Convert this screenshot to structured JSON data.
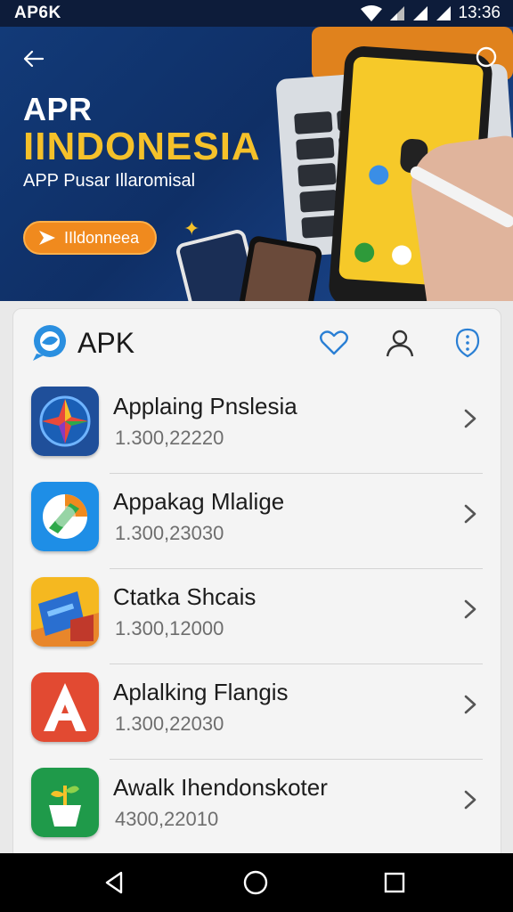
{
  "status_bar": {
    "left_label": "AP6K",
    "time": "13:36"
  },
  "banner": {
    "title": "APR",
    "headline": "IINDONESIA",
    "subtitle": "APP Pusar Illaromisal",
    "cta_label": "IIldonneea",
    "accent_color": "#f5c12a",
    "background_color": "#123a78"
  },
  "header": {
    "app_name": "APK",
    "icons": [
      "heart-icon",
      "user-icon",
      "more-info-icon"
    ],
    "accent_color": "#2a7fd4"
  },
  "apps": [
    {
      "title": "Applaing Pnslesia",
      "version": "1.300,22220",
      "icon": "compass-star-icon"
    },
    {
      "title": "Appakag Mlalige",
      "version": "1.300,23030",
      "icon": "circle-arrow-icon"
    },
    {
      "title": "Ctatka Shcais",
      "version": "1.300,12000",
      "icon": "tag-icon"
    },
    {
      "title": "Aplalking Flangis",
      "version": "1.300,22030",
      "icon": "letter-a-icon"
    },
    {
      "title": "Awalk Ihendonskoter",
      "version": "4300,22010",
      "icon": "plant-icon"
    }
  ],
  "nav_bar": {
    "buttons": [
      "back-triangle-icon",
      "home-circle-icon",
      "recents-square-icon"
    ]
  }
}
